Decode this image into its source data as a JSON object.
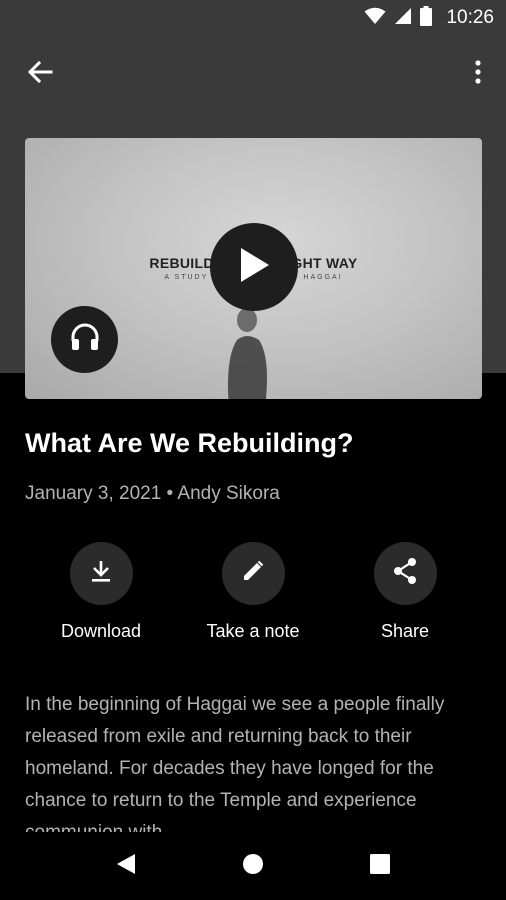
{
  "status_bar": {
    "time": "10:26",
    "icons": [
      "wifi-icon",
      "signal-icon",
      "battery-icon"
    ]
  },
  "app_bar": {
    "back_icon": "arrow-left-icon",
    "menu_icon": "more-vert-icon"
  },
  "media": {
    "thumbnail_title": "REBUILDING THE RIGHT WAY",
    "thumbnail_subtitle": "A STUDY OF THE BOOK OF HAGGAI",
    "play_icon": "play-icon",
    "audio_icon": "headphones-icon"
  },
  "sermon": {
    "title": "What Are We Rebuilding?",
    "date_speaker": "January 3, 2021 • Andy Sikora"
  },
  "actions": [
    {
      "label": "Download",
      "icon": "download-icon"
    },
    {
      "label": "Take a note",
      "icon": "pencil-icon"
    },
    {
      "label": "Share",
      "icon": "share-icon"
    }
  ],
  "description": "In the beginning of Haggai we see a people finally released from exile and returning back to their homeland. For decades they have longed for the chance to return to the Temple and experience communion with",
  "nav_bar": {
    "icons": [
      "back-triangle-icon",
      "home-circle-icon",
      "recents-square-icon"
    ]
  },
  "colors": {
    "header_bg": "#3a3a3a",
    "page_bg": "#000000",
    "secondary_text": "#b3b3b3",
    "button_bg": "#2b2b2b"
  }
}
